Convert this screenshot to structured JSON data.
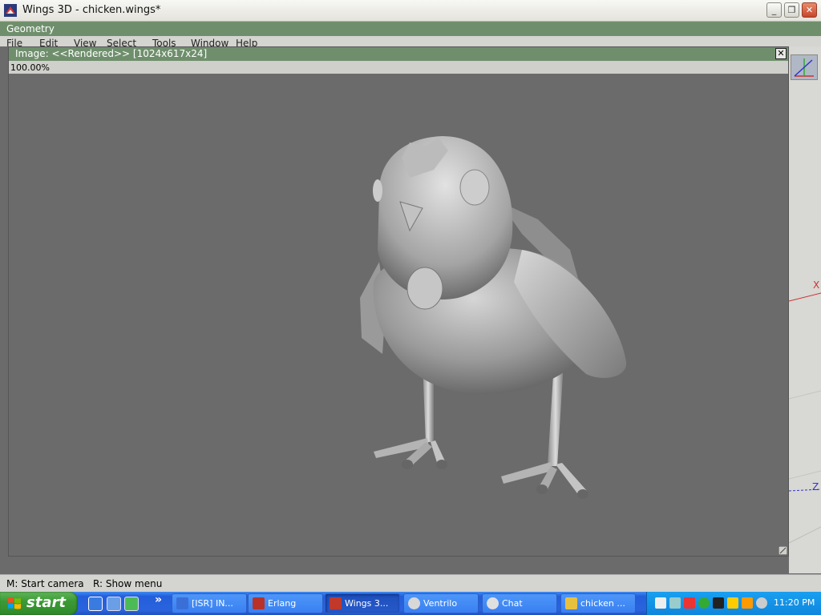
{
  "window": {
    "title": "Wings 3D - chicken.wings*",
    "buttons": [
      "_",
      "❐",
      "✕"
    ]
  },
  "geometry_bar": {
    "label": "Geometry"
  },
  "menu": {
    "items": [
      "File",
      "Edit",
      "View",
      "Select",
      "Tools",
      "Window",
      "Help"
    ]
  },
  "image_window": {
    "title": "Image: <<Rendered>> [1024x617x24]",
    "zoom": "100.00%",
    "close": "✕"
  },
  "viewport_axes": {
    "x": "X",
    "z": "Z"
  },
  "status": {
    "hint_camera": "M: Start camera",
    "hint_menu": "R: Show menu"
  },
  "taskbar": {
    "start": "start",
    "more": "»",
    "tasks": [
      {
        "label": "[ISR] IN...",
        "icon_color": "#3b6fd8"
      },
      {
        "label": "Erlang",
        "icon_color": "#b8322a"
      },
      {
        "label": "Wings 3...",
        "icon_color": "#c0392b"
      },
      {
        "label": "Ventrilo",
        "icon_color": "#d8d8d8"
      },
      {
        "label": "Chat",
        "icon_color": "#e0e0e0"
      },
      {
        "label": "chicken ...",
        "icon_color": "#e8c040"
      }
    ],
    "clock": "11:20 PM"
  }
}
